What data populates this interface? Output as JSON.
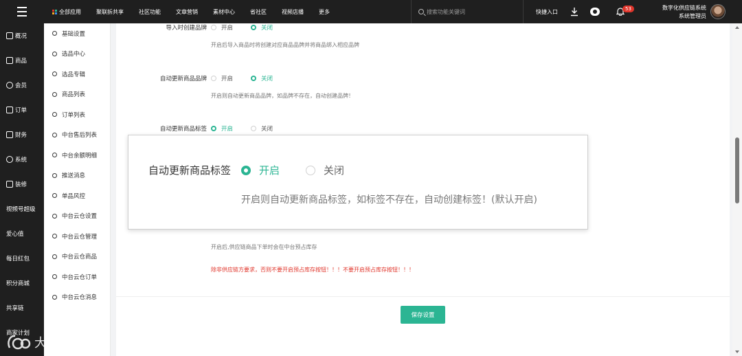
{
  "topbar": {
    "nav": [
      "全部应用",
      "聚联拆共享",
      "社区功能",
      "文章营销",
      "素材中心",
      "省社区",
      "视频店播",
      "更多"
    ],
    "search_placeholder": "搜索功能关键词",
    "quick_entry": "快捷入口",
    "notification_count": "53",
    "user_org": "数字化供应链系统",
    "user_role": "系统管理员"
  },
  "sidebar": {
    "items": [
      "概况",
      "商品",
      "会员",
      "订单",
      "财务",
      "系统",
      "装修",
      "视频号超级",
      "爱心值",
      "每日红包",
      "积分商城",
      "共享链",
      "商家计划"
    ]
  },
  "submenu": {
    "items": [
      "基础设置",
      "选品中心",
      "选品专辑",
      "商品列表",
      "订单列表",
      "中台售后列表",
      "中台余额明细",
      "推送消息",
      "单品风控",
      "中台云仓设置",
      "中台云仓管理",
      "中台云仓商品",
      "中台云仓订单",
      "中台云仓消息"
    ]
  },
  "settings": {
    "option_on": "开启",
    "option_off": "关闭",
    "row1": {
      "label": "导入时创建品牌",
      "hint": "开启后导入商品时将创建对应商品品牌并将商品绑入相应品牌"
    },
    "row2": {
      "label": "自动更新商品品牌",
      "hint": "开启则自动更新商品品牌，如品牌不存在，自动创建品牌！"
    },
    "row3": {
      "label": "自动更新商品标签"
    },
    "row5": {
      "hint": "开启后,供应链商品下单时会在中台预占库存",
      "warning": "除非供应链方要求，否则不要开启预占库存按钮！！！不要开启预占库存按钮！！！"
    },
    "save_label": "保存设置"
  },
  "zoom": {
    "label": "自动更新商品标签",
    "option_on": "开启",
    "option_off": "关闭",
    "hint": "开启则自动更新商品标签，如标签不存在，自动创建标签！(默认开启)"
  },
  "watermark": {
    "text": "大数跨境"
  },
  "colors": {
    "accent": "#2bb593",
    "warning": "#e0352b",
    "dark": "#1f1f1f"
  },
  "icons": {
    "apps": "apps-icon",
    "search": "search-icon",
    "download": "download-icon",
    "eye": "eye-icon",
    "bell": "bell-icon",
    "menu": "hamburger-icon"
  }
}
